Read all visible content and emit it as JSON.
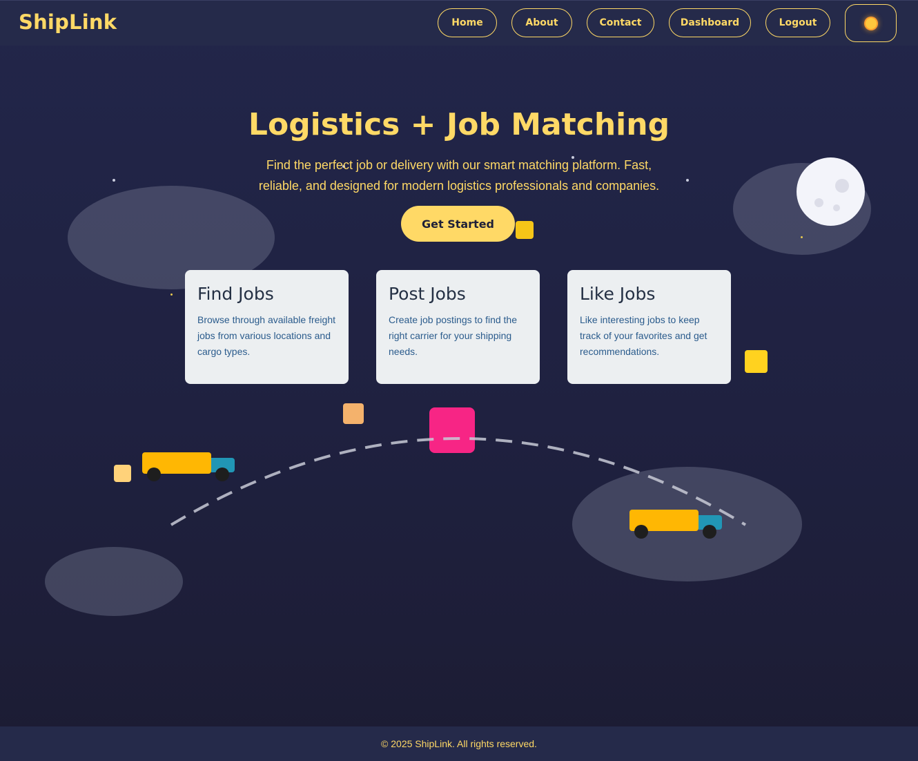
{
  "brand": {
    "name": "ShipLink"
  },
  "nav": {
    "items": [
      {
        "label": "Home"
      },
      {
        "label": "About"
      },
      {
        "label": "Contact"
      },
      {
        "label": "Dashboard"
      },
      {
        "label": "Logout"
      }
    ],
    "theme_toggle_icon": "sun-icon"
  },
  "hero": {
    "title": "Logistics + Job Matching",
    "subtitle": "Find the perfect job or delivery with our smart matching platform. Fast, reliable, and designed for modern logistics professionals and companies.",
    "cta_label": "Get Started"
  },
  "features": [
    {
      "title": "Find Jobs",
      "description": "Browse through available freight jobs from various locations and cargo types."
    },
    {
      "title": "Post Jobs",
      "description": "Create job postings to find the right carrier for your shipping needs."
    },
    {
      "title": "Like Jobs",
      "description": "Like interesting jobs to keep track of your favorites and get recommendations."
    }
  ],
  "footer": {
    "text": "© 2025 ShipLink. All rights reserved."
  },
  "colors": {
    "accent": "#ffd966",
    "background": "#22264a",
    "card": "#eceff1",
    "truck_body": "#ffb703",
    "truck_cab": "#2196b5",
    "package_pink": "#f72585"
  }
}
